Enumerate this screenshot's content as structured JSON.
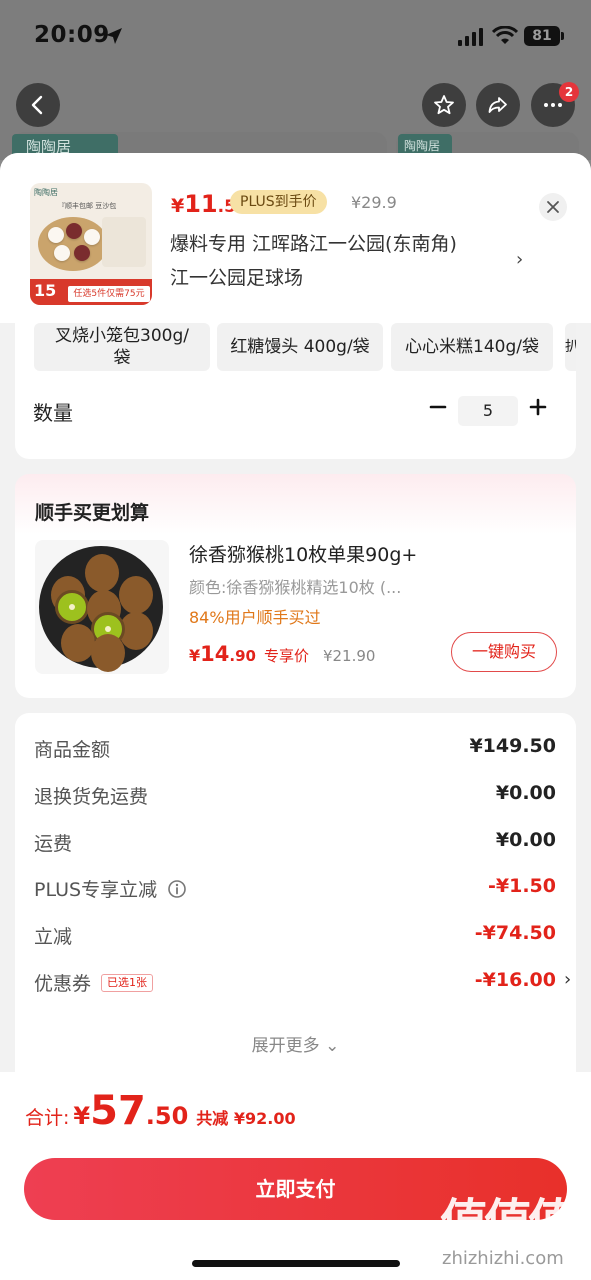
{
  "status_bar": {
    "time": "20:09",
    "battery": "81"
  },
  "nav": {
    "badge_count": "2"
  },
  "background": {
    "brand_left": "陶陶居",
    "brand_right": "陶陶居"
  },
  "product": {
    "price_symbol": "¥",
    "price_int": "11",
    "price_dec": ".5",
    "plus_tag": "PLUS到手价",
    "original_price": "¥29.9",
    "address_line1": "爆料专用  江晖路江一公园(东南角)",
    "address_line2": "江一公园足球场",
    "thumb": {
      "brand": "陶陶居",
      "tag": "『顺丰包邮 豆沙包",
      "big_number": "15",
      "promo": "任选5件仅需75元"
    }
  },
  "specs": [
    {
      "label": "叉烧小笼包300g/袋"
    },
    {
      "label": "红糖馒头 400g/袋"
    },
    {
      "label": "心心米糕140g/袋"
    },
    {
      "label": "扒"
    }
  ],
  "quantity": {
    "label": "数量",
    "value": "5",
    "minus": "−",
    "plus": "+"
  },
  "recommend": {
    "title": "顺手买更划算",
    "name": "徐香猕猴桃10枚单果90g+",
    "spec": "颜色:徐香猕猴桃精选10枚 (...",
    "social": "84%用户顺手买过",
    "price_symbol": "¥",
    "price_int": "14",
    "price_dec": ".90",
    "price_tag": "专享价",
    "original_price": "¥21.90",
    "buy_label": "一键购买"
  },
  "summary": {
    "rows": [
      {
        "label": "商品金额",
        "value": "¥149.50"
      },
      {
        "label": "退换货免运费",
        "value": "¥0.00"
      },
      {
        "label": "运费",
        "value": "¥0.00"
      },
      {
        "label": "PLUS专享立减",
        "value": "-¥1.50"
      },
      {
        "label": "立减",
        "value": "-¥74.50"
      },
      {
        "label": "优惠券",
        "value": "-¥16.00",
        "tag": "已选1张"
      }
    ],
    "expand": "展开更多 ⌄"
  },
  "bottom": {
    "total_label": "合计:",
    "total_sym": "¥",
    "total_int": "57",
    "total_dec": ".50",
    "total_discount": "共减 ¥92.00",
    "pay_label": "立即支付"
  },
  "watermark": {
    "chars": "值值值",
    "domain": "zhizhizhi.com"
  },
  "colors": {
    "accent": "#e2231a",
    "plus_gold": "#f7e1a5",
    "pay_gradient_start": "#ee3f52",
    "pay_gradient_end": "#e8302a"
  }
}
